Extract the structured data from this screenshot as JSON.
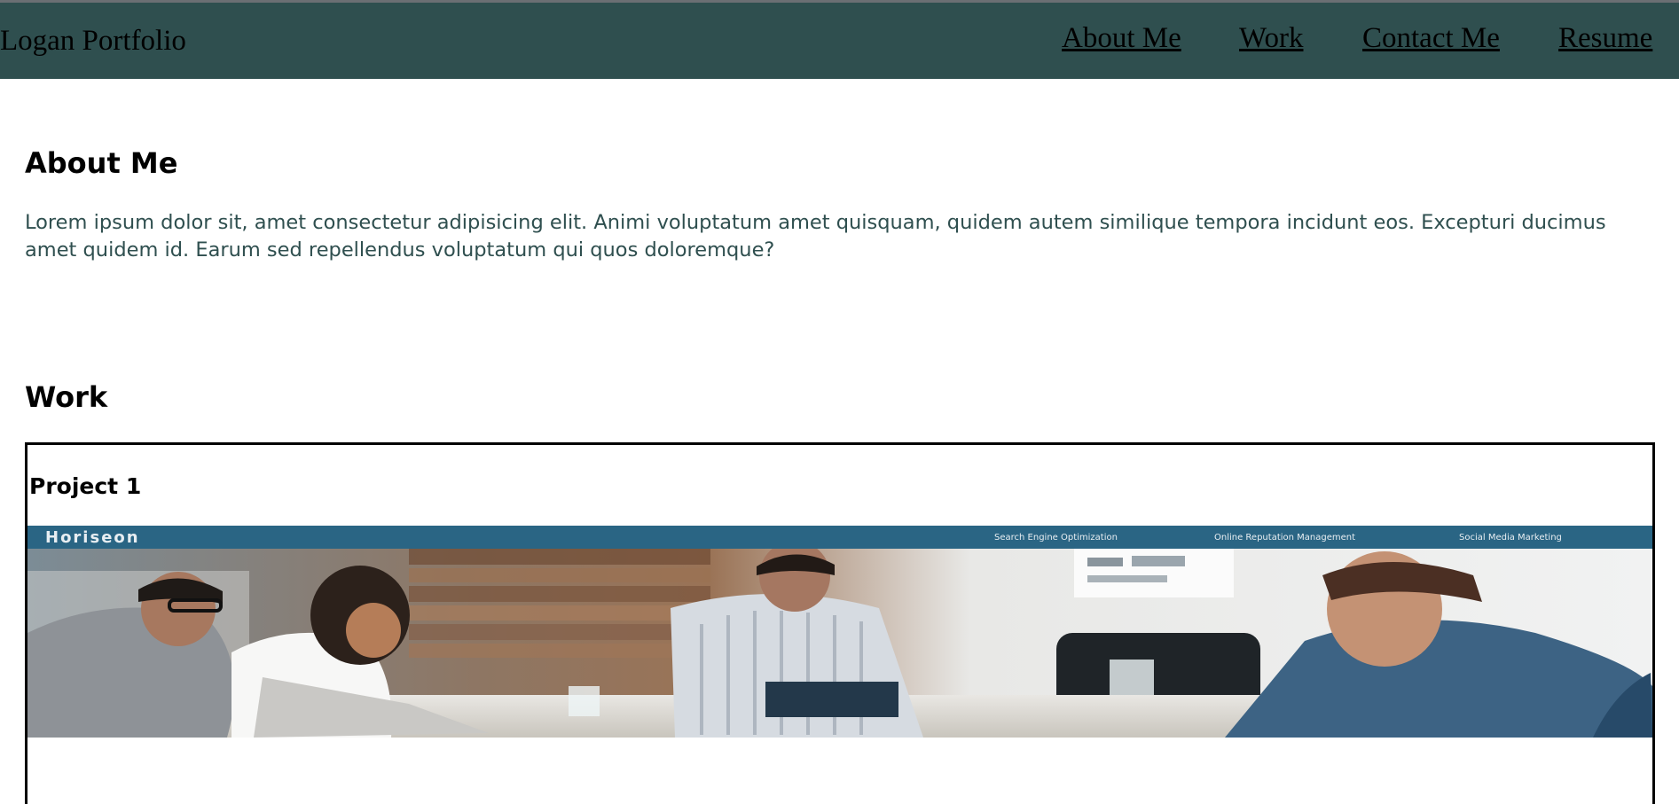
{
  "navbar": {
    "brand": "Logan Portfolio",
    "links": [
      "About Me",
      "Work",
      "Contact Me",
      "Resume"
    ]
  },
  "about": {
    "title": "About Me",
    "text": "Lorem ipsum dolor sit, amet consectetur adipisicing elit. Animi voluptatum amet quisquam, quidem autem similique tempora incidunt eos. Excepturi ducimus amet quidem id. Earum sed repellendus voluptatum qui quos doloremque?"
  },
  "work": {
    "title": "Work",
    "projects": [
      {
        "title": "Project 1",
        "screenshot": {
          "logo": "Horiseon",
          "nav": [
            "Search Engine Optimization",
            "Online Reputation Management",
            "Social Media Marketing"
          ]
        }
      }
    ]
  },
  "colors": {
    "navbar_bg": "#2f4f4f",
    "text_accent": "#2f4f4f",
    "project_header": "#2a6584"
  }
}
